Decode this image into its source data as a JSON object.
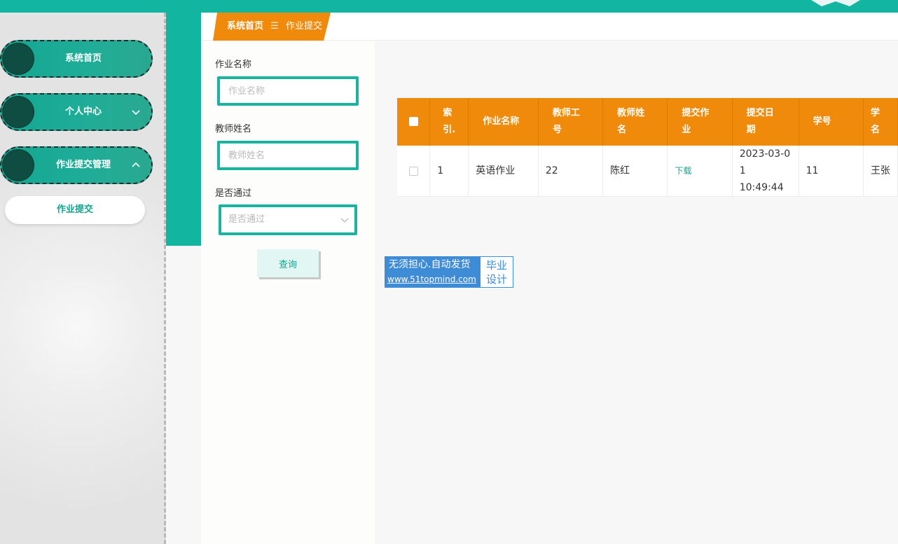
{
  "colors": {
    "primary": "#12b6a0",
    "accent": "#f08a0a",
    "link": "#12a58f"
  },
  "sidebar": {
    "items": [
      {
        "label": "系统首页",
        "chevron": ""
      },
      {
        "label": "个人中心",
        "chevron": "chevron-down-icon"
      },
      {
        "label": "作业提交管理",
        "chevron": "chevron-up-icon"
      }
    ],
    "submenu": [
      {
        "label": "作业提交"
      }
    ]
  },
  "breadcrumb": {
    "home": "系统首页",
    "separator": "☰",
    "current": "作业提交"
  },
  "filters": {
    "homework_name": {
      "label": "作业名称",
      "placeholder": "作业名称",
      "value": ""
    },
    "teacher_name": {
      "label": "教师姓名",
      "placeholder": "教师姓名",
      "value": ""
    },
    "passed": {
      "label": "是否通过",
      "placeholder": "是否通过"
    },
    "query_label": "查询"
  },
  "table": {
    "headers": [
      "索\n引.",
      "作业名称",
      "教师工\n号",
      "教师姓\n名",
      "提交作\n业",
      "提交日\n期",
      "学号",
      "学\n名"
    ],
    "rows": [
      {
        "index": "1",
        "homework_name": "英语作业",
        "teacher_id": "22",
        "teacher_name": "陈红",
        "file": "下载",
        "date": "2023-03-0\n1 10:49:44",
        "student_id": "11",
        "student_name": "王张"
      }
    ]
  },
  "watermark": {
    "line1": "无须担心.自动发货",
    "line2": "www.51topmind.com",
    "right1": "毕业",
    "right2": "设计"
  }
}
